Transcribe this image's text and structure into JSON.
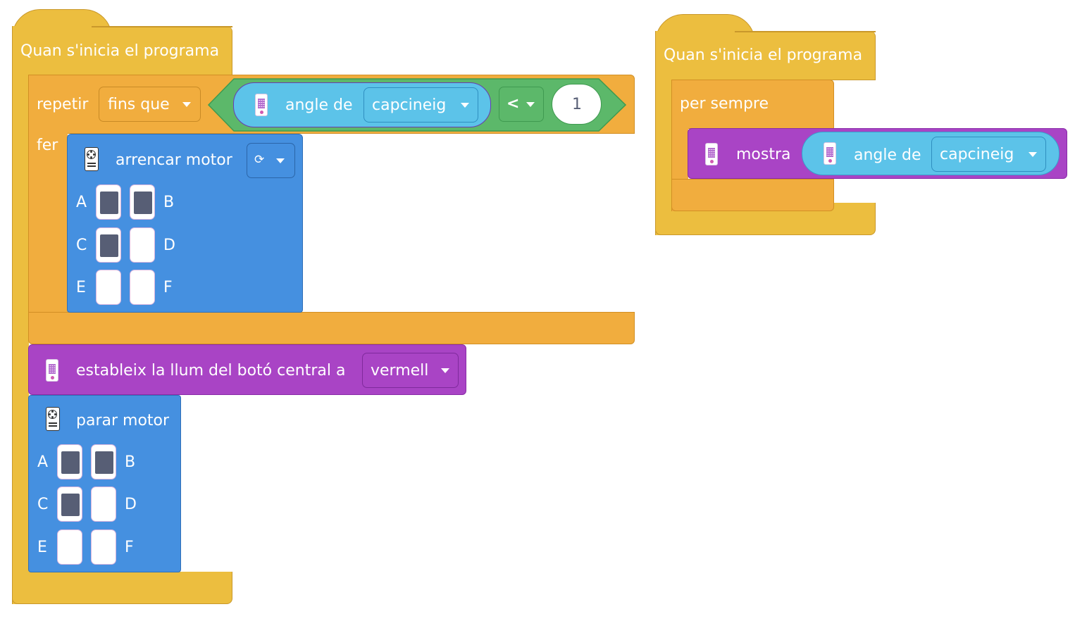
{
  "script1": {
    "hat_label": "Quan s'inicia el programa",
    "repeat": {
      "label": "repetir",
      "mode": "fins que",
      "do_label": "fer",
      "condition": {
        "sensor_label": "angle de",
        "axis": "capcineig",
        "operator": "<",
        "value": "1"
      }
    },
    "start_motor": {
      "label": "arrencar motor",
      "direction_icon": "⟳",
      "ports": [
        {
          "name": "A",
          "selected": true
        },
        {
          "name": "B",
          "selected": true
        },
        {
          "name": "C",
          "selected": true
        },
        {
          "name": "D",
          "selected": false
        },
        {
          "name": "E",
          "selected": false
        },
        {
          "name": "F",
          "selected": false
        }
      ]
    },
    "set_light": {
      "label": "estableix la llum del botó central a",
      "color": "vermell"
    },
    "stop_motor": {
      "label": "parar motor",
      "ports": [
        {
          "name": "A",
          "selected": true
        },
        {
          "name": "B",
          "selected": true
        },
        {
          "name": "C",
          "selected": true
        },
        {
          "name": "D",
          "selected": false
        },
        {
          "name": "E",
          "selected": false
        },
        {
          "name": "F",
          "selected": false
        }
      ]
    }
  },
  "script2": {
    "hat_label": "Quan s'inicia el programa",
    "forever_label": "per sempre",
    "display": {
      "label": "mostra",
      "sensor_label": "angle de",
      "axis": "capcineig"
    }
  },
  "colors": {
    "events": "#ecbe3f",
    "control": "#f1ad3e",
    "motors": "#4590e0",
    "hub": "#a944c5",
    "sensors": "#5cc3e9",
    "operators": "#5cb86a"
  }
}
